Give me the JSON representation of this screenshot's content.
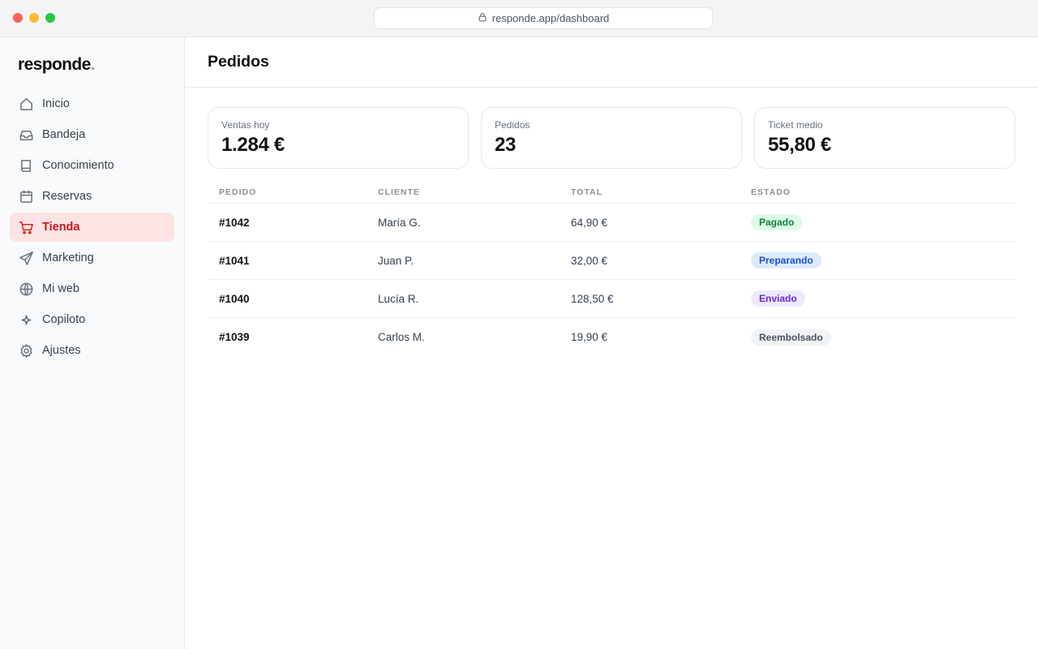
{
  "browser": {
    "url": "responde.app/dashboard",
    "traffic_light_colors": [
      "#ff5f57",
      "#febc2e",
      "#28c840"
    ]
  },
  "sidebar": {
    "logo": "responde",
    "logo_dot": ".",
    "items": [
      {
        "label": "Inicio",
        "icon": "home-icon",
        "active": false
      },
      {
        "label": "Bandeja",
        "icon": "inbox-icon",
        "active": false
      },
      {
        "label": "Conocimiento",
        "icon": "book-icon",
        "active": false
      },
      {
        "label": "Reservas",
        "icon": "calendar-icon",
        "active": false
      },
      {
        "label": "Tienda",
        "icon": "cart-icon",
        "active": true
      },
      {
        "label": "Marketing",
        "icon": "send-icon",
        "active": false
      },
      {
        "label": "Mi web",
        "icon": "globe-icon",
        "active": false
      },
      {
        "label": "Copiloto",
        "icon": "sparkle-icon",
        "active": false
      },
      {
        "label": "Ajustes",
        "icon": "gear-icon",
        "active": false
      }
    ]
  },
  "main": {
    "title": "Pedidos",
    "stats": [
      {
        "label": "Ventas hoy",
        "value": "1.284 €"
      },
      {
        "label": "Pedidos",
        "value": "23"
      },
      {
        "label": "Ticket medio",
        "value": "55,80 €"
      }
    ],
    "table": {
      "columns": [
        "PEDIDO",
        "CLIENTE",
        "TOTAL",
        "ESTADO"
      ],
      "rows": [
        {
          "id": "#1042",
          "customer": "María G.",
          "total": "64,90 €",
          "status": "Pagado"
        },
        {
          "id": "#1041",
          "customer": "Juan P.",
          "total": "32,00 €",
          "status": "Preparando"
        },
        {
          "id": "#1040",
          "customer": "Lucía R.",
          "total": "128,50 €",
          "status": "Enviado"
        },
        {
          "id": "#1039",
          "customer": "Carlos M.",
          "total": "19,90 €",
          "status": "Reembolsado"
        }
      ]
    }
  },
  "colors": {
    "accent": "#c8191b",
    "active_bg": "#fde3e3",
    "status": {
      "Pagado": {
        "bg": "#dcfce7",
        "fg": "#15803d"
      },
      "Preparando": {
        "bg": "#dbeafe",
        "fg": "#1d4ed8"
      },
      "Enviado": {
        "bg": "#ede9fe",
        "fg": "#6d28d9"
      },
      "Reembolsado": {
        "bg": "#f1f3f5",
        "fg": "#4b5563"
      }
    }
  }
}
